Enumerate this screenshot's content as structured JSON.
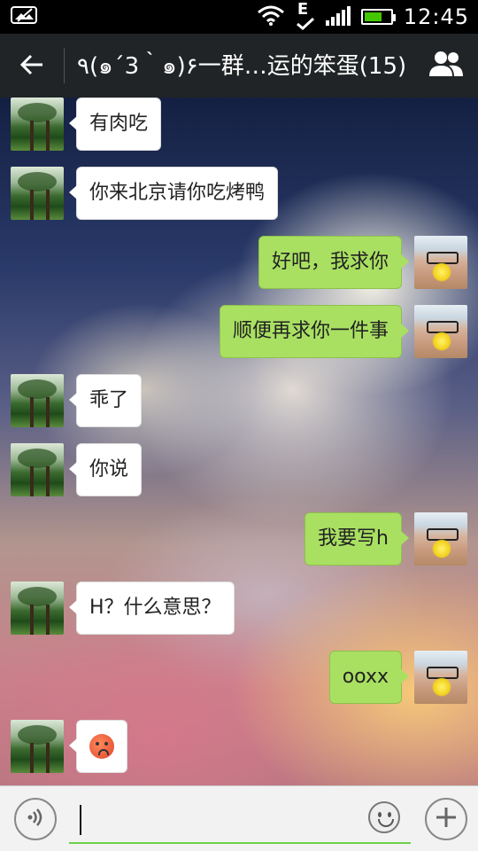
{
  "status_bar": {
    "time": "12:45",
    "network_type": "E",
    "icons": [
      "photo-icon",
      "wifi-icon",
      "network-e-icon",
      "signal-icon",
      "battery-icon"
    ]
  },
  "header": {
    "back_icon": "back-arrow-icon",
    "title": "٩(๑´3｀๑)۶一群…运的笨蛋(15)",
    "members_icon": "group-members-icon"
  },
  "messages": [
    {
      "side": "left",
      "text": "有肉吃"
    },
    {
      "side": "left",
      "text": "你来北京请你吃烤鸭"
    },
    {
      "side": "right",
      "text": "好吧，我求你"
    },
    {
      "side": "right",
      "text": "顺便再求你一件事"
    },
    {
      "side": "left",
      "text": "乖了"
    },
    {
      "side": "left",
      "text": "你说"
    },
    {
      "side": "right",
      "text": "我要写h"
    },
    {
      "side": "left",
      "text": "H？什么意思？"
    },
    {
      "side": "right",
      "text": "ooxx"
    },
    {
      "side": "left",
      "text": "",
      "emoji": "angry-face-emoji"
    }
  ],
  "input_bar": {
    "voice_icon": "voice-icon",
    "input_value": "",
    "emoji_icon": "smiley-icon",
    "add_icon": "plus-icon"
  },
  "colors": {
    "status_bg": "#000000",
    "header_bg": "#202426",
    "incoming_bubble": "#ffffff",
    "outgoing_bubble": "#a9e062",
    "input_underline": "#6ccf4b"
  }
}
